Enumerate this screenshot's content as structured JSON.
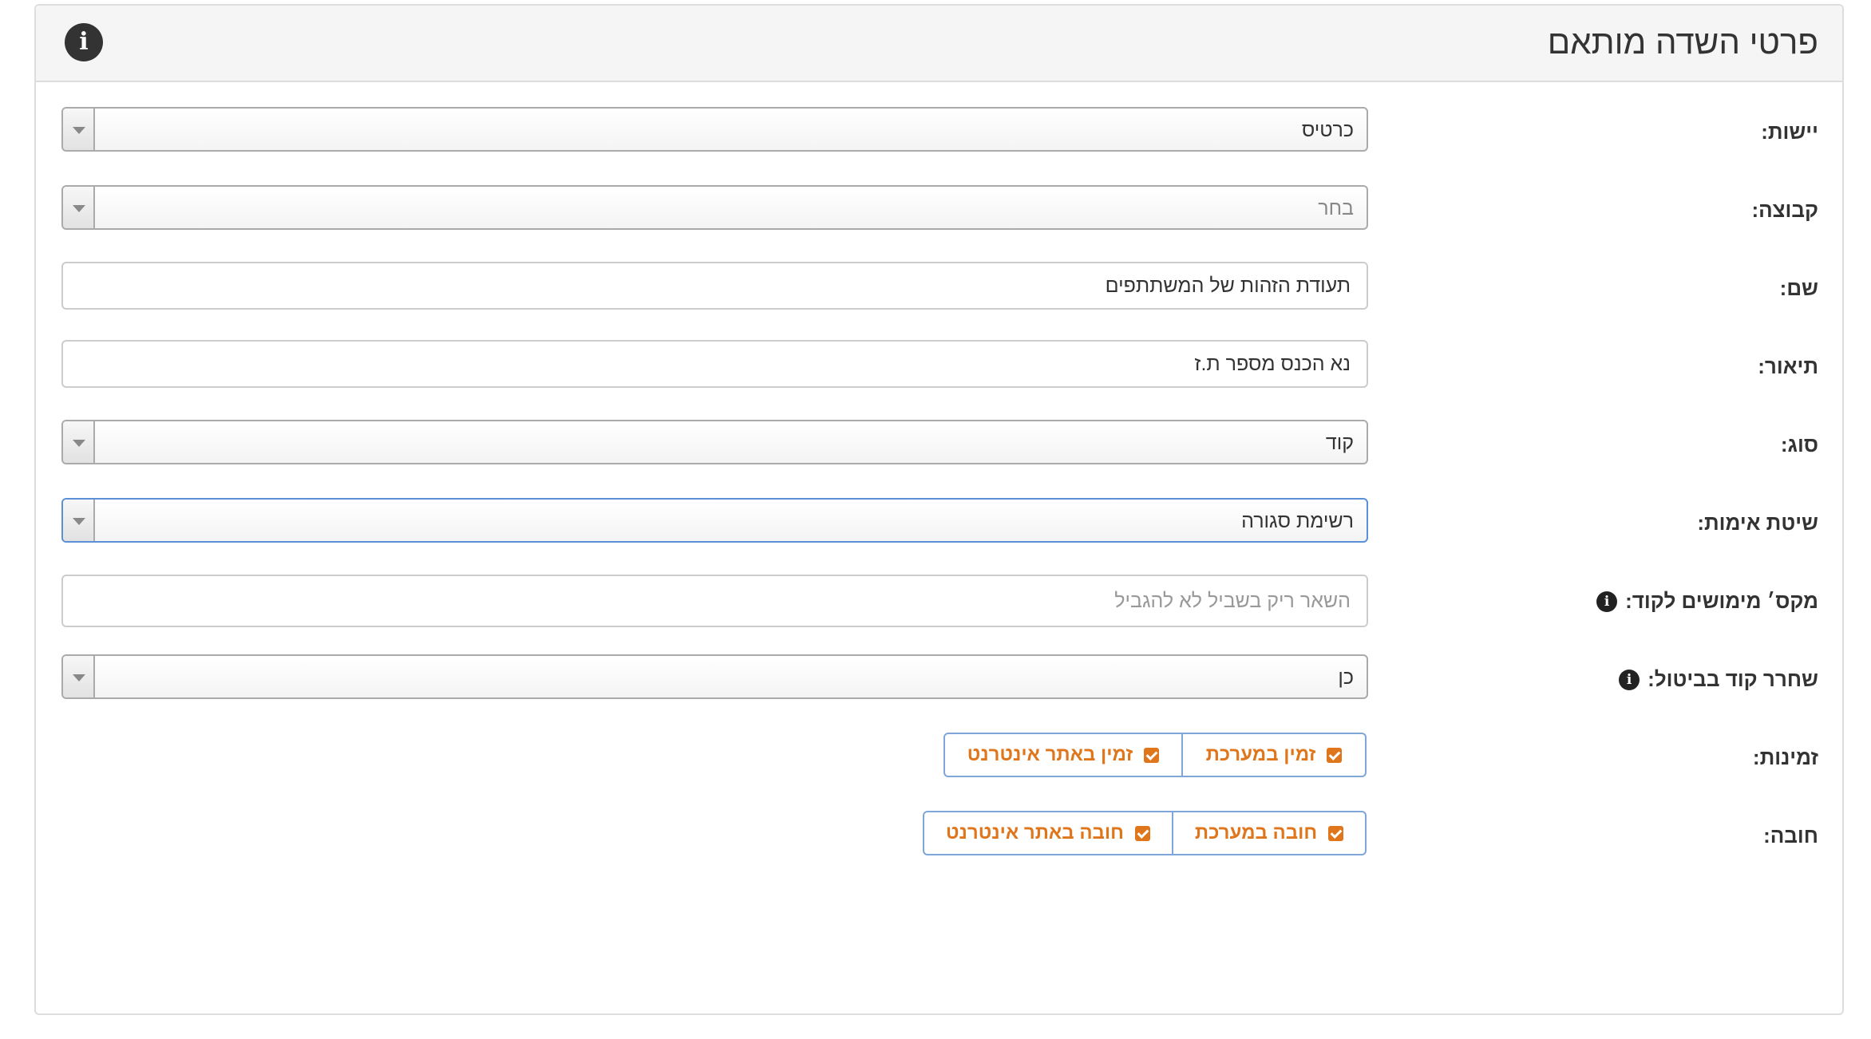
{
  "header": {
    "title": "פרטי השדה מותאם",
    "info_icon": "info-icon"
  },
  "fields": {
    "entity": {
      "label": "יישות:",
      "value": "כרטיס"
    },
    "group": {
      "label": "קבוצה:",
      "placeholder": "בחר"
    },
    "name": {
      "label": "שם:",
      "value": "תעודת הזהות של המשתתפים"
    },
    "description": {
      "label": "תיאור:",
      "value": "נא הכנס מספר ת.ז"
    },
    "type": {
      "label": "סוג:",
      "value": "קוד"
    },
    "validation": {
      "label": "שיטת אימות:",
      "value": "רשימת סגורה"
    },
    "max_uses": {
      "label": "מקס׳ מימושים לקוד:",
      "placeholder": "השאר ריק בשביל לא להגביל"
    },
    "release_on_cancel": {
      "label": "שחרר קוד בביטול:",
      "value": "כן"
    },
    "availability": {
      "label": "זמינות:",
      "options": [
        "זמין במערכת",
        "זמין באתר אינטרנט"
      ]
    },
    "required": {
      "label": "חובה:",
      "options": [
        "חובה במערכת",
        "חובה באתר אינטרנט"
      ]
    }
  },
  "colors": {
    "accent": "#e0761c",
    "button_border": "#7fa6d9",
    "focus_border": "#5b8fd6",
    "header_bg": "#f5f5f5"
  }
}
